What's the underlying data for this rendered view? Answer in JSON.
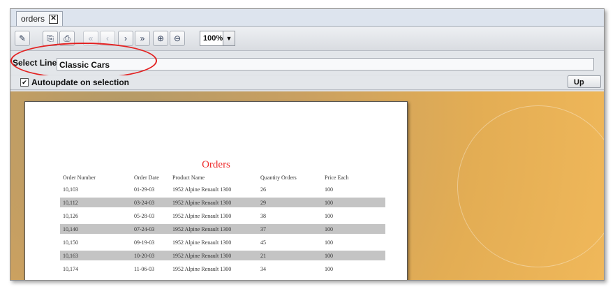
{
  "tab": {
    "title": "orders",
    "close_glyph": "✕"
  },
  "toolbar": {
    "buttons": [
      {
        "icon": "pencil-icon",
        "glyph": "✎"
      },
      {
        "icon": "export-icon",
        "glyph": "⎘"
      },
      {
        "icon": "print-icon",
        "glyph": "⎙"
      },
      {
        "icon": "first-page-icon",
        "glyph": "«"
      },
      {
        "icon": "prev-page-icon",
        "glyph": "‹"
      },
      {
        "icon": "next-page-icon",
        "glyph": "›"
      },
      {
        "icon": "last-page-icon",
        "glyph": "»"
      },
      {
        "icon": "zoom-in-icon",
        "glyph": "⊕"
      },
      {
        "icon": "zoom-out-icon",
        "glyph": "⊖"
      }
    ],
    "zoom_value": "100%",
    "zoom_arrow": "▼"
  },
  "select_line": {
    "label": "Select Line",
    "value": "Classic Cars"
  },
  "autoupdate": {
    "label": "Autoupdate on selection",
    "checked": true,
    "check_glyph": "✔"
  },
  "update_button": {
    "label": "Up"
  },
  "report": {
    "title": "Orders",
    "title_color": "#ee2b2b",
    "headers": [
      "Order Number",
      "Order Date",
      "Product Name",
      "Quantity Orders",
      "Price Each"
    ],
    "rows": [
      [
        "10,103",
        "01-29-03",
        "1952 Alpine Renault 1300",
        "26",
        "100"
      ],
      [
        "10,112",
        "03-24-03",
        "1952 Alpine Renault 1300",
        "29",
        "100"
      ],
      [
        "10,126",
        "05-28-03",
        "1952 Alpine Renault 1300",
        "38",
        "100"
      ],
      [
        "10,140",
        "07-24-03",
        "1952 Alpine Renault 1300",
        "37",
        "100"
      ],
      [
        "10,150",
        "09-19-03",
        "1952 Alpine Renault 1300",
        "45",
        "100"
      ],
      [
        "10,163",
        "10-20-03",
        "1952 Alpine Renault 1300",
        "21",
        "100"
      ],
      [
        "10,174",
        "11-06-03",
        "1952 Alpine Renault 1300",
        "34",
        "100"
      ]
    ]
  }
}
